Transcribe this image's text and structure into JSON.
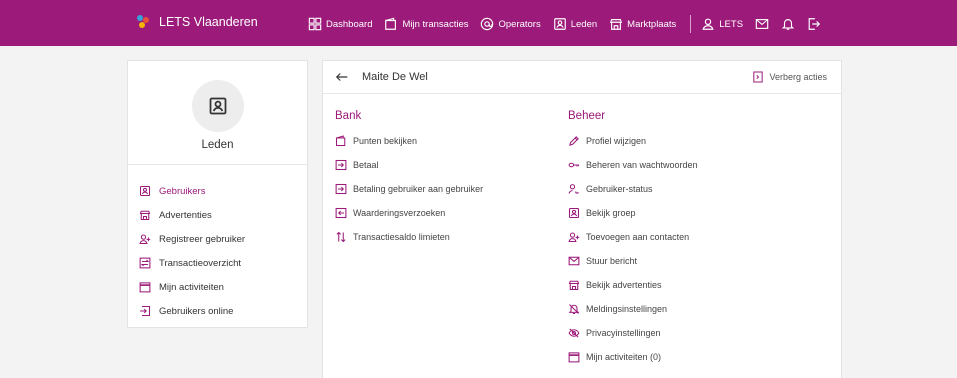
{
  "colors": {
    "brand": "#9c1a7a",
    "background": "#f3f3f3"
  },
  "topbar": {
    "title": "LETS Vlaanderen",
    "nav": [
      {
        "label": "Dashboard",
        "icon": "dashboard-icon"
      },
      {
        "label": "Mijn transacties",
        "icon": "wallet-icon"
      },
      {
        "label": "Operators",
        "icon": "at-icon"
      },
      {
        "label": "Leden",
        "icon": "contact-card-icon"
      },
      {
        "label": "Marktplaats",
        "icon": "store-icon"
      }
    ],
    "account_label": "LETS"
  },
  "sidebar": {
    "title": "Leden",
    "items": [
      {
        "label": "Gebruikers",
        "icon": "contact-card-icon",
        "active": true
      },
      {
        "label": "Advertenties",
        "icon": "store-icon"
      },
      {
        "label": "Registreer gebruiker",
        "icon": "user-add-icon"
      },
      {
        "label": "Transactieoverzicht",
        "icon": "transactions-icon"
      },
      {
        "label": "Mijn activiteiten",
        "icon": "calendar-icon"
      },
      {
        "label": "Gebruikers online",
        "icon": "login-icon"
      }
    ]
  },
  "main": {
    "title": "Maite De Wel",
    "hide_actions_label": "Verberg acties",
    "bank": {
      "heading": "Bank",
      "items": [
        {
          "label": "Punten bekijken",
          "icon": "wallet-icon"
        },
        {
          "label": "Betaal",
          "icon": "pay-icon"
        },
        {
          "label": "Betaling gebruiker aan gebruiker",
          "icon": "pay-icon"
        },
        {
          "label": "Waarderingsverzoeken",
          "icon": "request-icon"
        },
        {
          "label": "Transactiesaldo limieten",
          "icon": "sort-arrows-icon"
        }
      ]
    },
    "beheer": {
      "heading": "Beheer",
      "items": [
        {
          "label": "Profiel wijzigen",
          "icon": "pencil-icon"
        },
        {
          "label": "Beheren van wachtwoorden",
          "icon": "key-icon"
        },
        {
          "label": "Gebruiker-status",
          "icon": "user-status-icon"
        },
        {
          "label": "Bekijk groep",
          "icon": "group-icon"
        },
        {
          "label": "Toevoegen aan contacten",
          "icon": "user-add-icon"
        },
        {
          "label": "Stuur bericht",
          "icon": "mail-icon"
        },
        {
          "label": "Bekijk advertenties",
          "icon": "store-icon"
        },
        {
          "label": "Meldingsinstellingen",
          "icon": "bell-off-icon"
        },
        {
          "label": "Privacyinstellingen",
          "icon": "eye-off-icon"
        },
        {
          "label": "Mijn activiteiten (0)",
          "icon": "calendar-icon"
        }
      ]
    }
  }
}
